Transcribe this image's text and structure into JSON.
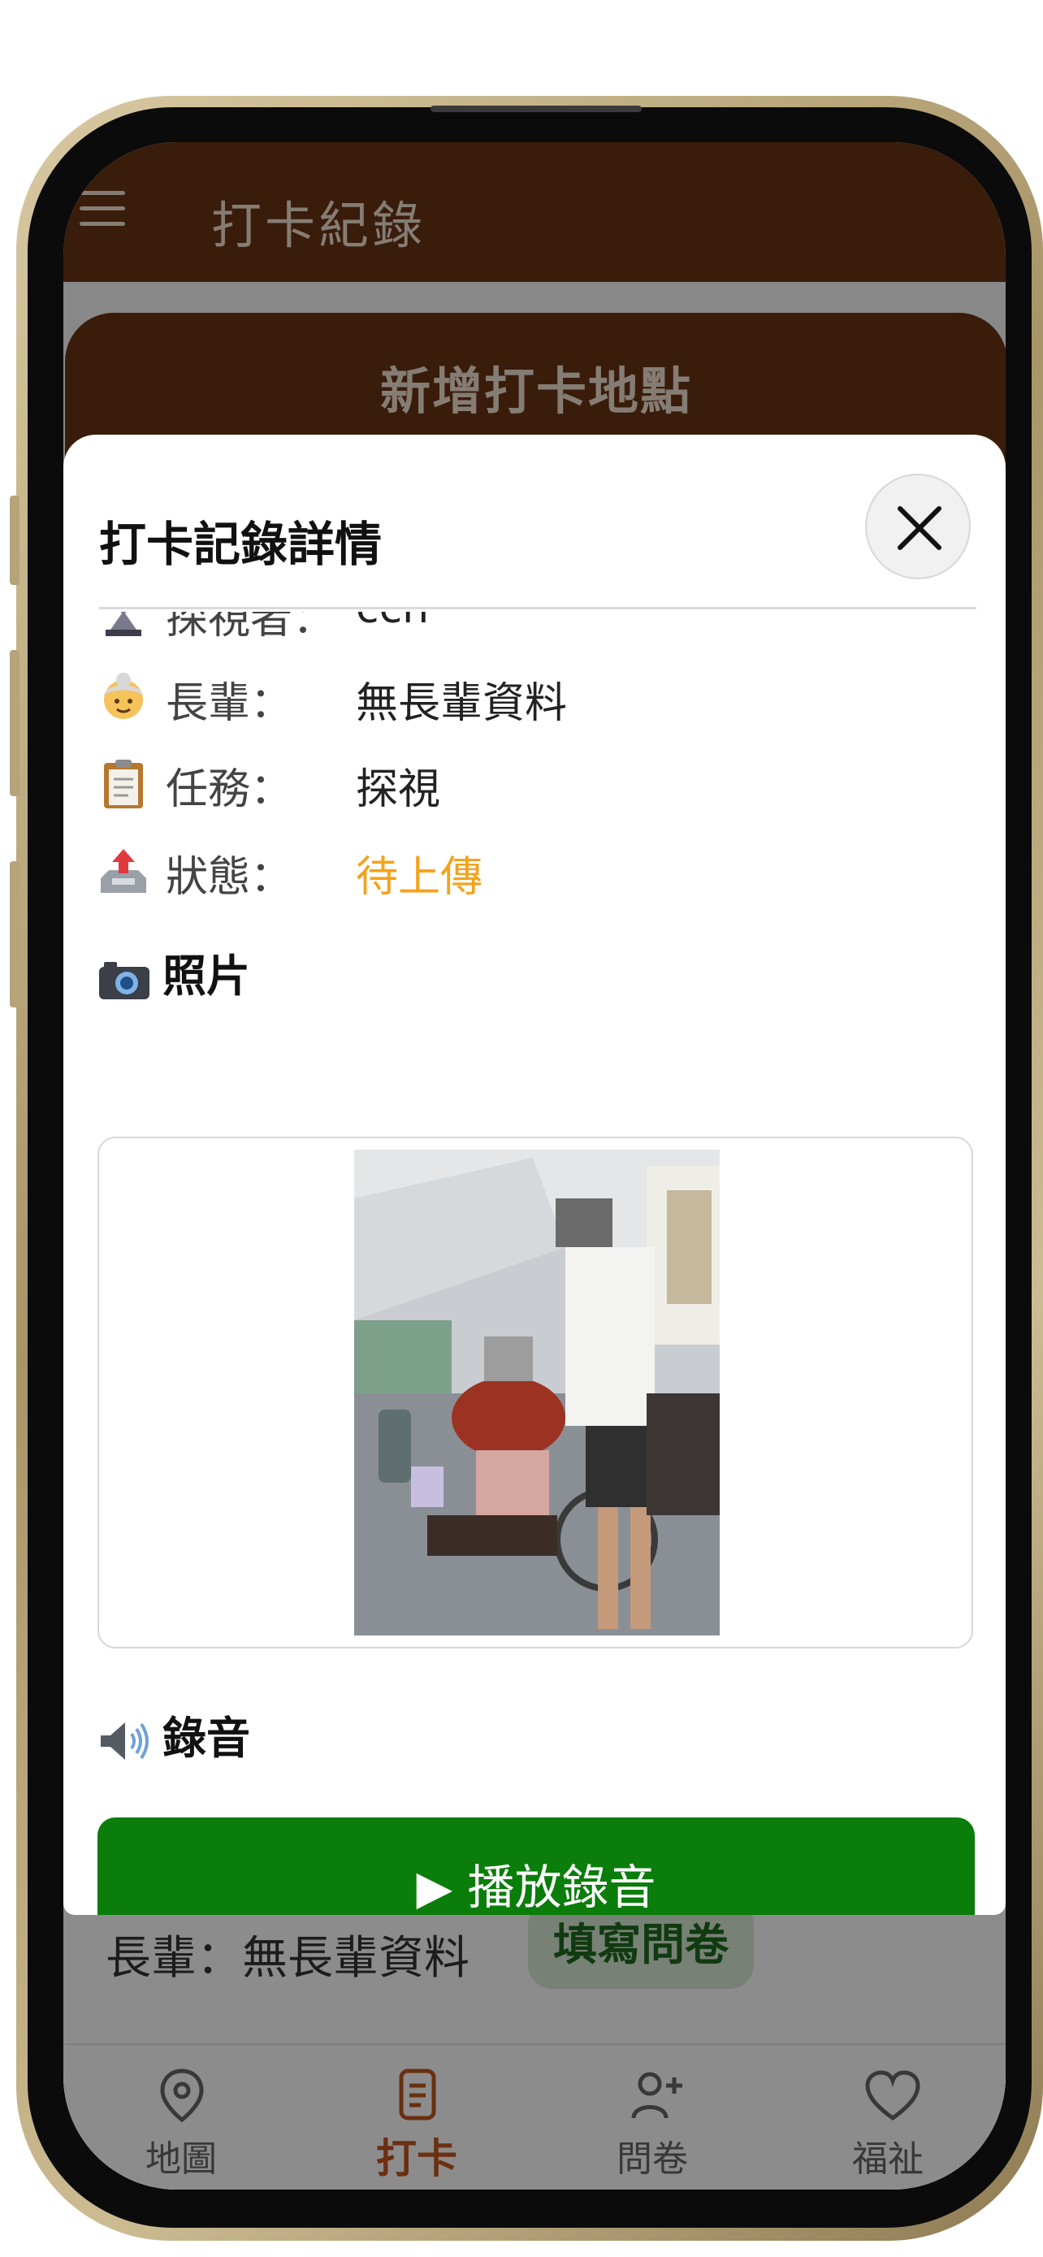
{
  "header": {
    "title": "打卡紀錄"
  },
  "add_place_button": "新增打卡地點",
  "record": {
    "elder_line": "長輩：無長輩資料",
    "survey_button": "填寫問卷"
  },
  "bottom_nav": [
    {
      "label": "地圖",
      "icon": "map-pin-icon",
      "active": false
    },
    {
      "label": "打卡",
      "icon": "document-icon",
      "active": true
    },
    {
      "label": "問卷",
      "icon": "add-person-icon",
      "active": false
    },
    {
      "label": "福祉",
      "icon": "heart-icon",
      "active": false
    }
  ],
  "modal": {
    "title": "打卡記錄詳情",
    "close_icon": "close-icon",
    "rows": [
      {
        "icon": "hourglass-icon",
        "label": "探視者：",
        "value": "ccn"
      },
      {
        "icon": "older-woman-icon",
        "label": "長輩：",
        "value": "無長輩資料"
      },
      {
        "icon": "clipboard-icon",
        "label": "任務：",
        "value": "探視"
      },
      {
        "icon": "outbox-tray-icon",
        "label": "狀態：",
        "value": "待上傳"
      }
    ],
    "photo_section": {
      "icon": "camera-icon",
      "title": "照片"
    },
    "audio_section": {
      "icon": "speaker-icon",
      "title": "錄音"
    },
    "play_button": "▶ 播放錄音"
  },
  "colors": {
    "brand_brown": "#6a3414",
    "play_green": "#0a7d0a",
    "pending_orange": "#f5a21b",
    "nav_active": "#c2581f"
  }
}
